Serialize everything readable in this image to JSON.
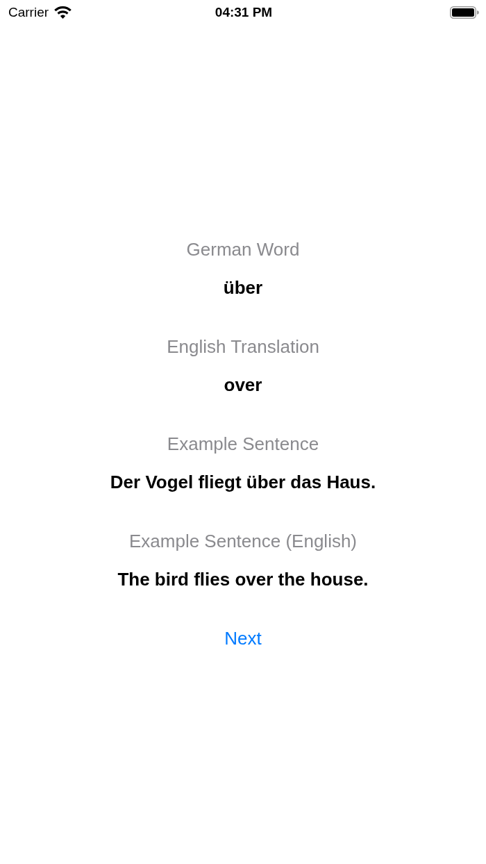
{
  "status_bar": {
    "carrier": "Carrier",
    "time": "04:31 PM"
  },
  "fields": [
    {
      "label": "German Word",
      "value": "über"
    },
    {
      "label": "English Translation",
      "value": "over"
    },
    {
      "label": "Example Sentence",
      "value": "Der Vogel fliegt über das Haus."
    },
    {
      "label": "Example Sentence (English)",
      "value": "The bird flies over the house."
    }
  ],
  "next_button": {
    "label": "Next"
  }
}
